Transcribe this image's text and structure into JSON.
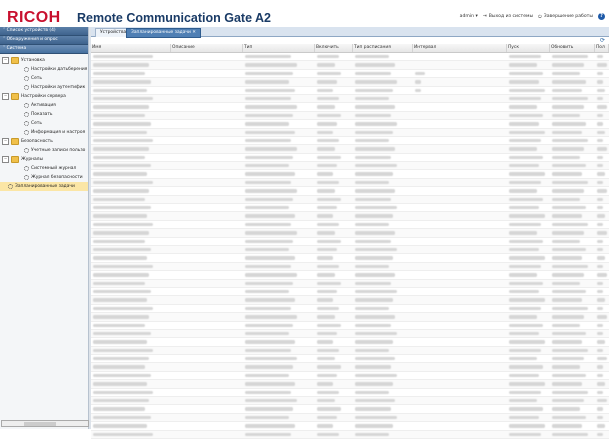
{
  "header": {
    "logo": "RICOH",
    "title": "Remote Communication Gate A2",
    "user": "admin ▾",
    "logout": "Выход из системы",
    "shutdown": "Завершение работы",
    "help": "?"
  },
  "sidebar": {
    "sections": [
      {
        "label": "Список устройств (4)"
      },
      {
        "label": "Обнаружения и опрос"
      },
      {
        "label": "Система"
      }
    ],
    "tree": [
      {
        "label": "Установка"
      },
      {
        "label": "Настройки датьберения"
      },
      {
        "label": "Сеть"
      },
      {
        "label": "Настройки аутентифик"
      },
      {
        "label": "Настройки сервера"
      },
      {
        "label": "Активация"
      },
      {
        "label": "Показать"
      },
      {
        "label": "Сеть"
      },
      {
        "label": "Информация и настроя"
      },
      {
        "label": "Безопасность"
      },
      {
        "label": "Учетные записи пользо"
      },
      {
        "label": "Журналы"
      },
      {
        "label": "Системный журнал"
      },
      {
        "label": "Журнал безопасности"
      },
      {
        "label": "Запланированные задачи"
      }
    ]
  },
  "tabs": [
    {
      "label": "Устройства"
    },
    {
      "label": "Запланированные задачи ✕"
    }
  ],
  "grid": {
    "columns": [
      "Имя",
      "Описание",
      "Тип",
      "Включить",
      "Тип расписания",
      "Интервал",
      "Пуск",
      "Обновить",
      "Пол"
    ],
    "row_count": 46
  },
  "colors": {
    "brand": "#c8102e",
    "title": "#1a3b66",
    "accordion": "#4a6f9a",
    "selected": "#fbe6a6"
  }
}
